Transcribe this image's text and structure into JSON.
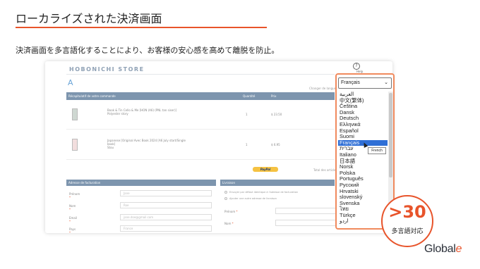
{
  "slide": {
    "title": "ローカライズされた決済画面",
    "subtitle": "決済画面を多言語化することにより、お客様の安心感を高めて離脱を防止。"
  },
  "store": {
    "name": "HOBONICHI STORE",
    "help_label": "Help",
    "lang_hint": "Changer de langue",
    "table_headers": [
      "Récapitulatif de votre commande",
      "Quantité",
      "Prix"
    ],
    "products": [
      {
        "name": "Book & Tin Cello & Me [HON (A6) (PNL tan siser)]",
        "variant": "Polyester story",
        "qty": "1",
        "price": "$ 23.50"
      },
      {
        "name": "Japanese [Original Avec Book 2024 [A6 July start/Single book]",
        "variant": "Stou",
        "qty": "1",
        "price": "$ 6.95"
      }
    ],
    "paypal_label": "PayPal",
    "total_label": "Total des articles",
    "billing_header": "Adresse de facturation",
    "shipping_header": "Livraison",
    "billing_fields": [
      {
        "label": "Prénom",
        "value": "Jane"
      },
      {
        "label": "Nom",
        "value": "Roe"
      },
      {
        "label": "Email",
        "value": "jane.doe@gmail.com"
      },
      {
        "label": "Pays",
        "value": "France"
      }
    ],
    "shipping_options": [
      "Envoyer par défaut identique à l'adresse de facturation",
      "Ajouter une autre adresse de livraison"
    ],
    "shipping_fields": [
      {
        "label": "Prénom"
      },
      {
        "label": "Nom"
      }
    ]
  },
  "language_select": {
    "selected": "Français",
    "options": [
      "العربية",
      "中文(繁体)",
      "Čeština",
      "Dansk",
      "Deutsch",
      "Ελληνικά",
      "Español",
      "Suomi",
      "Français",
      "עברית",
      "Italiano",
      "日本語",
      "Norsk",
      "Polska",
      "Português",
      "Русский",
      "Hrvatski",
      "slovenský",
      "Svenska",
      "ไทย",
      "Türkçe",
      "اردو"
    ],
    "highlighted_index": 8,
    "tooltip": "French"
  },
  "badge": {
    "count": ">30",
    "caption": "多言語対応"
  },
  "brand": {
    "name_main": "Global",
    "name_accent": "e"
  },
  "colors": {
    "accent": "#e8542b",
    "header_bar": "#7d95ae",
    "selection": "#2f6fd6"
  }
}
